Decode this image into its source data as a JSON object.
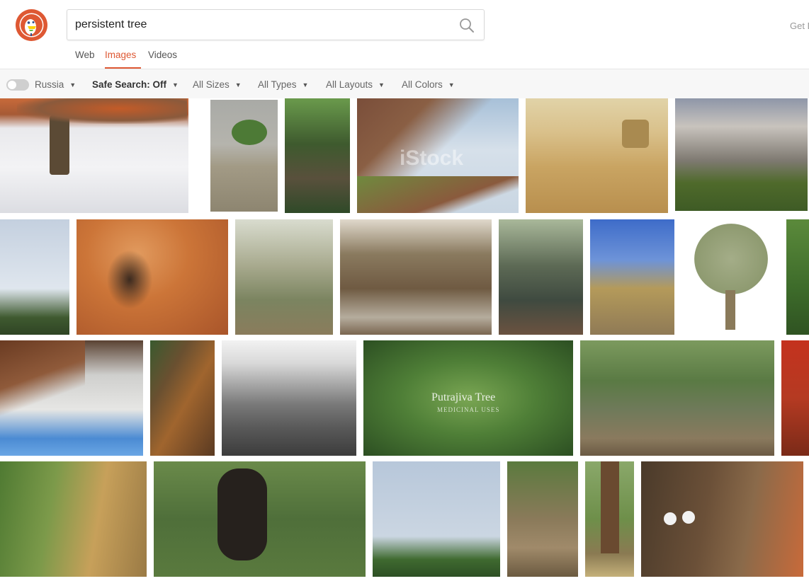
{
  "search": {
    "query": "persistent tree",
    "button": "search-icon"
  },
  "header": {
    "right_text": "Get D"
  },
  "tabs": [
    {
      "label": "Web",
      "active": false
    },
    {
      "label": "Images",
      "active": true
    },
    {
      "label": "Videos",
      "active": false
    }
  ],
  "filters": {
    "region_toggle_on": false,
    "region": "Russia",
    "safe_search": "Safe Search: Off",
    "size": "All Sizes",
    "type": "All Types",
    "layout": "All Layouts",
    "color": "All Colors"
  },
  "image_overlays": {
    "istock": "iStock",
    "putrajiva_title": "Putrajiva Tree",
    "putrajiva_sub": "MEDICINAL USES"
  },
  "colors": {
    "accent": "#de5833",
    "logo_bg": "#de5833"
  }
}
